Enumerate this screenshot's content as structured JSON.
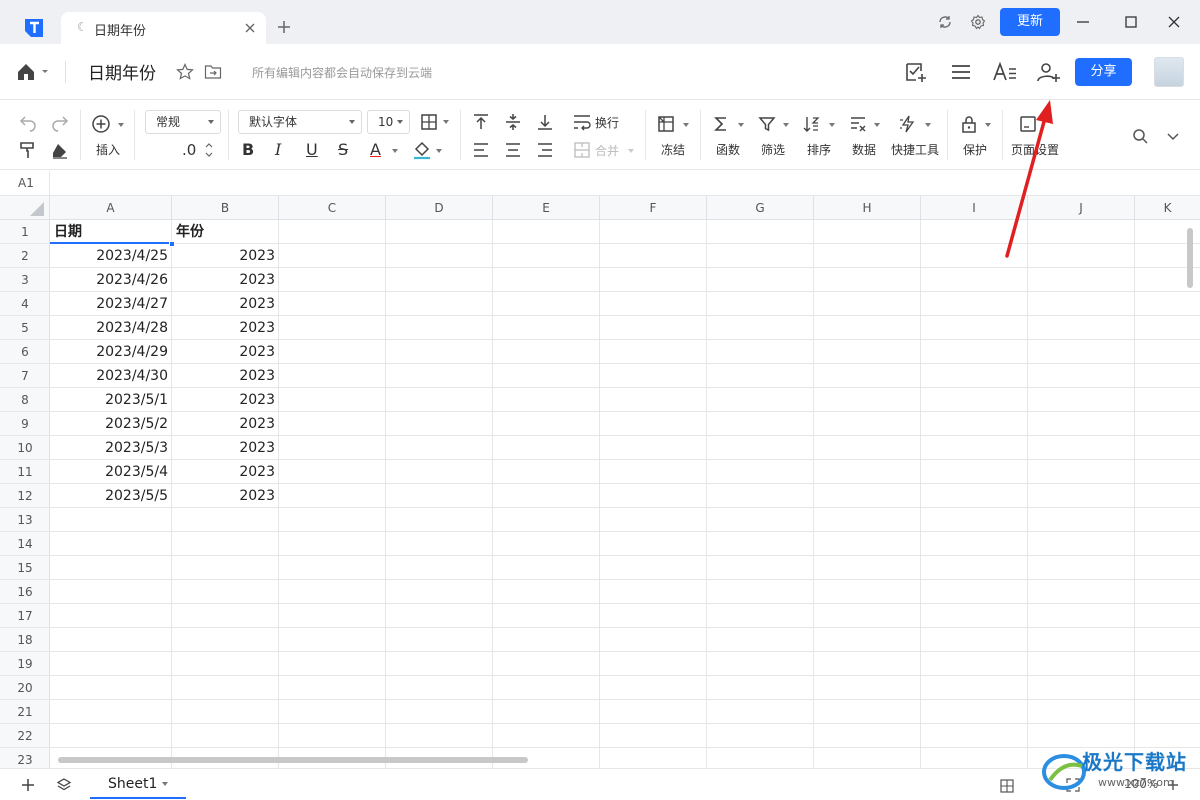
{
  "tab": {
    "title": "日期年份"
  },
  "titlebar": {
    "update_label": "更新"
  },
  "doc": {
    "title": "日期年份",
    "save_hint": "所有编辑内容都会自动保存到云端",
    "share_label": "分享"
  },
  "toolbar": {
    "insert_label": "插入",
    "number_format": "常规",
    "decimal_label": ".0",
    "font_family": "默认字体",
    "font_size": "10",
    "wrap_label": "换行",
    "merge_label": "合并",
    "freeze_label": "冻结",
    "function_label": "函数",
    "filter_label": "筛选",
    "sort_label": "排序",
    "data_label": "数据",
    "quicktools_label": "快捷工具",
    "protect_label": "保护",
    "pagesetup_label": "页面设置",
    "bold_glyph": "B",
    "italic_glyph": "I",
    "underline_glyph": "U",
    "strike_glyph": "S",
    "fontcolor_glyph": "A"
  },
  "formula_bar": {
    "cell_ref": "A1"
  },
  "columns": [
    "A",
    "B",
    "C",
    "D",
    "E",
    "F",
    "G",
    "H",
    "I",
    "J",
    "K"
  ],
  "rows": [
    "1",
    "2",
    "3",
    "4",
    "5",
    "6",
    "7",
    "8",
    "9",
    "10",
    "11",
    "12",
    "13",
    "14",
    "15",
    "16",
    "17",
    "18",
    "19",
    "20",
    "21",
    "22",
    "23"
  ],
  "cells": {
    "header": [
      "日期",
      "年份"
    ],
    "data": [
      [
        "2023/4/25",
        "2023"
      ],
      [
        "2023/4/26",
        "2023"
      ],
      [
        "2023/4/27",
        "2023"
      ],
      [
        "2023/4/28",
        "2023"
      ],
      [
        "2023/4/29",
        "2023"
      ],
      [
        "2023/4/30",
        "2023"
      ],
      [
        "2023/5/1",
        "2023"
      ],
      [
        "2023/5/2",
        "2023"
      ],
      [
        "2023/5/3",
        "2023"
      ],
      [
        "2023/5/4",
        "2023"
      ],
      [
        "2023/5/5",
        "2023"
      ]
    ]
  },
  "sheets": {
    "active": "Sheet1"
  },
  "zoom": {
    "level": "100%"
  },
  "watermark": {
    "title": "极光下载站",
    "url": "www.xz7.com"
  },
  "colors": {
    "accent": "#1f6eff",
    "arrow": "#e02020"
  }
}
